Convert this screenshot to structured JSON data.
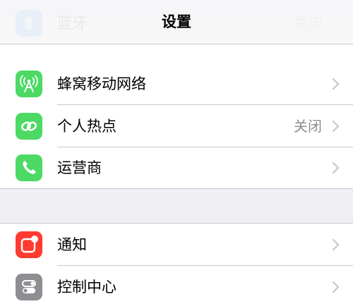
{
  "navbar": {
    "title": "设置"
  },
  "colors": {
    "bluetooth": "#1f7cf7",
    "cellular": "#4cd964",
    "hotspot": "#4cd964",
    "carrier": "#4cd964",
    "notifications": "#ff3b30",
    "control_center": "#8e8e93",
    "secondary_text": "#8e8e93"
  },
  "settings": {
    "group1": [
      {
        "label": "蓝牙",
        "value": "关闭",
        "icon": "bluetooth-icon"
      },
      {
        "label": "蜂窝移动网络",
        "value": "",
        "icon": "cellular-antenna-icon"
      },
      {
        "label": "个人热点",
        "value": "关闭",
        "icon": "hotspot-link-icon"
      },
      {
        "label": "运营商",
        "value": "",
        "icon": "phone-icon"
      }
    ],
    "group2": [
      {
        "label": "通知",
        "value": "",
        "icon": "notifications-icon"
      },
      {
        "label": "控制中心",
        "value": "",
        "icon": "control-center-icon"
      }
    ]
  }
}
